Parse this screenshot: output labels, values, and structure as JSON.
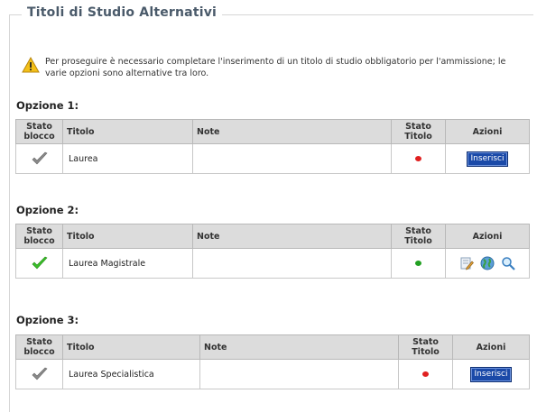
{
  "fieldset": {
    "legend": "Titoli di Studio Alternativi"
  },
  "warning": {
    "icon": "warning-icon",
    "text": "Per proseguire è necessario completare l'inserimento di un titolo di studio obbligatorio per l'ammissione; le varie opzioni sono alternative tra loro."
  },
  "columns": {
    "stato_blocco": "Stato blocco",
    "titolo": "Titolo",
    "note": "Note",
    "stato_titolo": "Stato Titolo",
    "azioni": "Azioni"
  },
  "colors": {
    "status_missing": "#e02020",
    "status_ok": "#22a022",
    "check_gray": "#8a8a8a",
    "check_green": "#3bbf2a",
    "button_bg": "#1b4aa8"
  },
  "options": [
    {
      "title": "Opzione 1:",
      "row": {
        "stato_blocco": "check-gray-icon",
        "titolo": "Laurea",
        "note": "",
        "stato_titolo": "red",
        "action_label": "Inserisci"
      }
    },
    {
      "title": "Opzione 2:",
      "row": {
        "stato_blocco": "check-green-icon",
        "titolo": "Laurea Magistrale",
        "note": "",
        "stato_titolo": "green",
        "actions": [
          "edit-icon",
          "globe-icon",
          "magnifier-icon"
        ]
      }
    },
    {
      "title": "Opzione 3:",
      "row": {
        "stato_blocco": "check-gray-icon",
        "titolo": "Laurea Specialistica",
        "note": "",
        "stato_titolo": "red",
        "action_label": "Inserisci"
      }
    }
  ]
}
